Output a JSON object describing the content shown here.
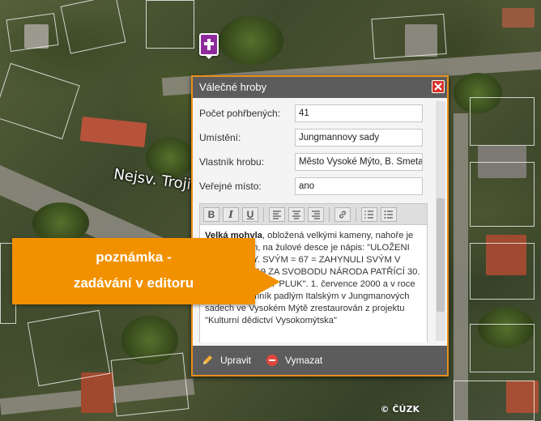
{
  "popup": {
    "title": "Válečné hroby",
    "fields": [
      {
        "label": "Počet pohřbených:",
        "value": "41"
      },
      {
        "label": "Umístění:",
        "value": "Jungmannovy sady"
      },
      {
        "label": "Vlastník hrobu:",
        "value": "Město Vysoké Mýto, B. Smetany"
      },
      {
        "label": "Veřejné místo:",
        "value": "ano"
      }
    ],
    "toolbar": {
      "bold": "B",
      "italic": "I",
      "underline": "U"
    },
    "note": {
      "bold_lead": "Velká mohyla",
      "text": ", obložená velkými kameny, nahoře je vytesán vojín, na žulové desce je nápis: \"ULOŽENI DO MOHYLY. SVÝM = 67 = ZAHYNULI SVÝM V ČERVNU 1919 ZA SVOBODU NÁRODA PATŘÍCÍ 30. ČS. STŘELECKÝ PLUK\". 1. července 2000 a v roce 2008 byl pomník padlým Italským v Jungmanových sadech ve Vysokém Mýtě zrestaurován z projektu \"Kulturní dědictví Vysokomýtska\""
    },
    "footer": {
      "edit": "Upravit",
      "delete": "Vymazat"
    }
  },
  "callout": {
    "line1": "poznámka -",
    "line2": "zadávání v editoru"
  },
  "map": {
    "street_label": "Nejsv. Trojic",
    "copyright": "© ČÚZK"
  },
  "colors": {
    "accent": "#e98f1c",
    "callout": "#f29100",
    "header": "#5c5c5c",
    "marker": "#8e2a9b",
    "close": "#d9332b"
  }
}
